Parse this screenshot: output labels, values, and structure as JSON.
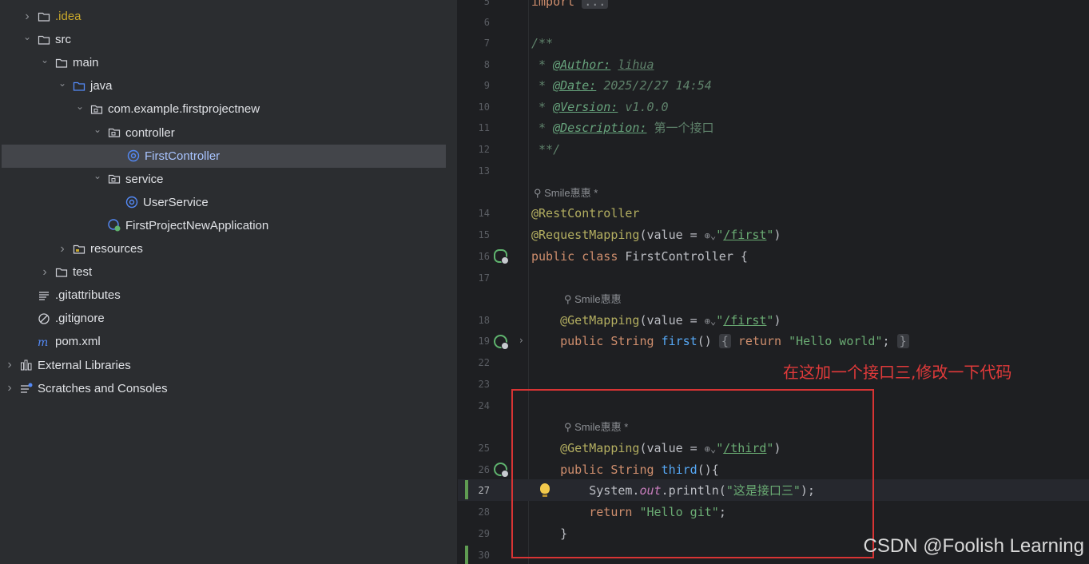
{
  "project_tree": [
    {
      "id": "idea",
      "label": ".idea",
      "indent": 1,
      "chevron": "right",
      "icon": "folder-icon",
      "style": "idea"
    },
    {
      "id": "src",
      "label": "src",
      "indent": 1,
      "chevron": "down",
      "icon": "folder-icon"
    },
    {
      "id": "main",
      "label": "main",
      "indent": 2,
      "chevron": "down",
      "icon": "folder-icon"
    },
    {
      "id": "java",
      "label": "java",
      "indent": 3,
      "chevron": "down",
      "icon": "source-folder-icon"
    },
    {
      "id": "package",
      "label": "com.example.firstprojectnew",
      "indent": 4,
      "chevron": "down",
      "icon": "package-icon"
    },
    {
      "id": "controller",
      "label": "controller",
      "indent": 5,
      "chevron": "down",
      "icon": "package-icon"
    },
    {
      "id": "firstcontroller",
      "label": "FirstController",
      "indent": 6,
      "chevron": "none",
      "icon": "class-icon",
      "selected": true
    },
    {
      "id": "service",
      "label": "service",
      "indent": 5,
      "chevron": "down",
      "icon": "package-icon"
    },
    {
      "id": "userservice",
      "label": "UserService",
      "indent": 6,
      "chevron": "none",
      "icon": "class-icon"
    },
    {
      "id": "app",
      "label": "FirstProjectNewApplication",
      "indent": 5,
      "chevron": "none",
      "icon": "spring-boot-class-icon"
    },
    {
      "id": "resources",
      "label": "resources",
      "indent": 3,
      "chevron": "right",
      "icon": "resources-folder-icon"
    },
    {
      "id": "test",
      "label": "test",
      "indent": 2,
      "chevron": "right",
      "icon": "folder-icon"
    },
    {
      "id": "gitattributes",
      "label": ".gitattributes",
      "indent": 1,
      "chevron": "none",
      "icon": "text-file-icon"
    },
    {
      "id": "gitignore",
      "label": ".gitignore",
      "indent": 1,
      "chevron": "none",
      "icon": "ignore-file-icon"
    },
    {
      "id": "pom",
      "label": "pom.xml",
      "indent": 1,
      "chevron": "none",
      "icon": "maven-icon"
    },
    {
      "id": "extlibs",
      "label": "External Libraries",
      "indent": 0,
      "chevron": "right",
      "icon": "libraries-icon"
    },
    {
      "id": "scratches",
      "label": "Scratches and Consoles",
      "indent": 0,
      "chevron": "right",
      "icon": "scratches-icon"
    }
  ],
  "editor": {
    "line_numbers": [
      "5",
      "6",
      "7",
      "8",
      "9",
      "10",
      "11",
      "12",
      "13",
      "14",
      "15",
      "16",
      "17",
      "18",
      "19",
      "22",
      "23",
      "24",
      "25",
      "26",
      "27",
      "28",
      "29",
      "30"
    ],
    "active_line": "27",
    "code": {
      "import_kw": "import",
      "import_fold": "...",
      "doc_open": "/**",
      "author_tag": "@Author:",
      "author_val": "lihua",
      "date_tag": "@Date:",
      "date_val": "2025/2/27 14:54",
      "version_tag": "@Version:",
      "version_val": "v1.0.0",
      "desc_tag": "@Description:",
      "desc_val": "第一个接口",
      "doc_close": "**/",
      "rest_controller": "@RestController",
      "request_mapping": "@RequestMapping",
      "mapping_args_open": "(value = ",
      "first_path": "/first",
      "class_decl_kw": "public class",
      "class_name": "FirstController {",
      "get_mapping": "@GetMapping",
      "public_string": "public String",
      "method_first": "first",
      "first_body_return": "return",
      "hello_world": "\"Hello world\"",
      "third_path": "/third",
      "method_third": "third",
      "system": "System.",
      "out": "out",
      "println": ".println(",
      "println_arg": "\"这是接口三\"",
      "println_end": ");",
      "return_kw": "return",
      "hello_git": "\"Hello git\"",
      "close_brace": "}"
    },
    "author_hints": {
      "class_hint": "Smile惠惠 *",
      "first_hint": "Smile惠惠",
      "third_hint": "Smile惠惠 *"
    }
  },
  "annotation_note": "在这加一个接口三,修改一下代码",
  "watermark": "CSDN @Foolish Learning",
  "colors": {
    "background": "#1e1f22",
    "sidebar": "#2b2d30",
    "highlight_box": "#d83434",
    "keyword": "#cf8e6d",
    "string": "#6aab73",
    "annotation": "#b3ae60"
  }
}
